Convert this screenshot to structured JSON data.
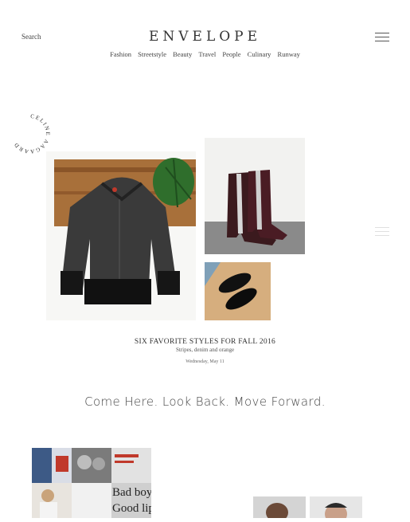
{
  "header": {
    "search_label": "Search",
    "logo": "ENVELOPE",
    "nav": [
      "Fashion",
      "Streetstyle",
      "Beauty",
      "Travel",
      "People",
      "Culinary",
      "Runway"
    ]
  },
  "badge": {
    "text": "CELINE AAGAARD"
  },
  "feature": {
    "title": "SIX FAVORITE STYLES FOR FALL 2016",
    "subtitle": "Stripes, denim and orange",
    "date": "Wednesday, May 11"
  },
  "tagline": "Come Here. Look Back. Move Forward.",
  "collage": {
    "text_lines": [
      "Bad boy,",
      "Good lip"
    ]
  },
  "colors": {
    "text": "#333333",
    "background": "#ffffff"
  },
  "icons": {
    "menu": "hamburger-icon"
  }
}
